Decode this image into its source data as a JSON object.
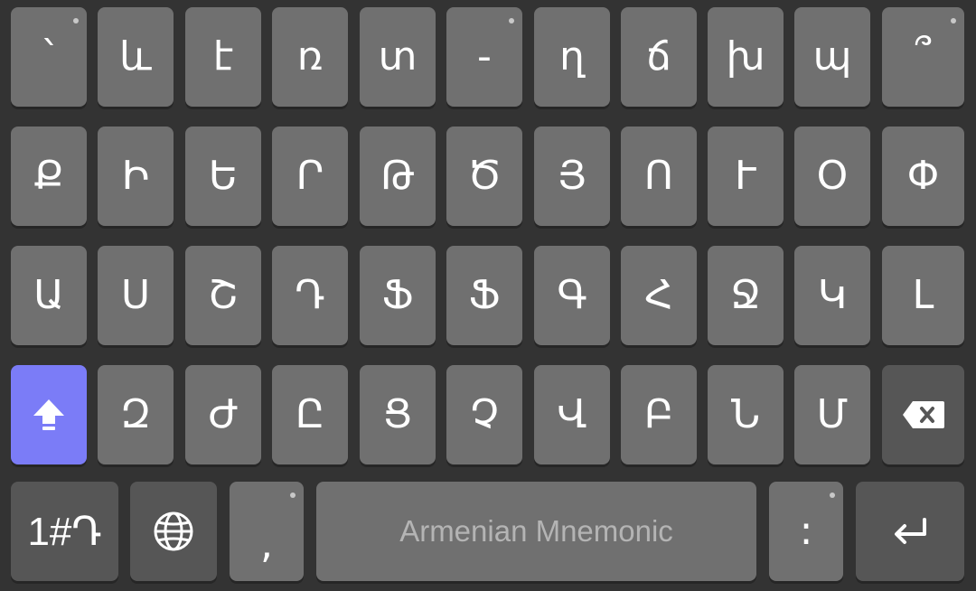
{
  "keyboard": {
    "rows": [
      [
        {
          "label": "՝",
          "hint": true,
          "name": "key-armenian-accent"
        },
        {
          "label": "և",
          "hint": false,
          "name": "key-ev"
        },
        {
          "label": "է",
          "hint": false,
          "name": "key-e-small"
        },
        {
          "label": "ռ",
          "hint": false,
          "name": "key-rra"
        },
        {
          "label": "տ",
          "hint": false,
          "name": "key-tiwn"
        },
        {
          "label": "-",
          "hint": true,
          "name": "key-hyphen"
        },
        {
          "label": "ղ",
          "hint": false,
          "name": "key-ghad"
        },
        {
          "label": "ճ",
          "hint": false,
          "name": "key-cheh"
        },
        {
          "label": "խ",
          "hint": false,
          "name": "key-xeh"
        },
        {
          "label": "պ",
          "hint": false,
          "name": "key-peh"
        },
        {
          "label": "՞",
          "hint": true,
          "name": "key-question-mark"
        }
      ],
      [
        {
          "label": "Ք",
          "hint": false,
          "name": "key-keh"
        },
        {
          "label": "Ի",
          "hint": false,
          "name": "key-ini"
        },
        {
          "label": "Ե",
          "hint": false,
          "name": "key-yech"
        },
        {
          "label": "Ր",
          "hint": false,
          "name": "key-reh"
        },
        {
          "label": "Թ",
          "hint": false,
          "name": "key-to"
        },
        {
          "label": "Ծ",
          "hint": false,
          "name": "key-ca"
        },
        {
          "label": "Յ",
          "hint": false,
          "name": "key-yi"
        },
        {
          "label": "Ո",
          "hint": false,
          "name": "key-vo"
        },
        {
          "label": "Ւ",
          "hint": false,
          "name": "key-yiwn"
        },
        {
          "label": "Օ",
          "hint": false,
          "name": "key-oh"
        },
        {
          "label": "Փ",
          "hint": false,
          "name": "key-piwr"
        }
      ],
      [
        {
          "label": "Ա",
          "hint": false,
          "name": "key-ayb"
        },
        {
          "label": "Ս",
          "hint": false,
          "name": "key-seh"
        },
        {
          "label": "Շ",
          "hint": false,
          "name": "key-sha"
        },
        {
          "label": "Դ",
          "hint": false,
          "name": "key-da"
        },
        {
          "label": "Ֆ",
          "hint": false,
          "name": "key-feh"
        },
        {
          "label": "Ֆ",
          "hint": false,
          "name": "key-feh-2"
        },
        {
          "label": "Գ",
          "hint": false,
          "name": "key-gim"
        },
        {
          "label": "Հ",
          "hint": false,
          "name": "key-ho"
        },
        {
          "label": "Ջ",
          "hint": false,
          "name": "key-jheh"
        },
        {
          "label": "Կ",
          "hint": false,
          "name": "key-ken"
        },
        {
          "label": "Լ",
          "hint": false,
          "name": "key-liwn"
        }
      ],
      [
        {
          "label": "Զ",
          "hint": false,
          "name": "key-za"
        },
        {
          "label": "Ժ",
          "hint": false,
          "name": "key-zhe"
        },
        {
          "label": "Ը",
          "hint": false,
          "name": "key-et"
        },
        {
          "label": "Ց",
          "hint": false,
          "name": "key-co"
        },
        {
          "label": "Չ",
          "hint": false,
          "name": "key-cha"
        },
        {
          "label": "Վ",
          "hint": false,
          "name": "key-vew"
        },
        {
          "label": "Բ",
          "hint": false,
          "name": "key-ben"
        },
        {
          "label": "Ն",
          "hint": false,
          "name": "key-now"
        },
        {
          "label": "Մ",
          "hint": false,
          "name": "key-men"
        }
      ]
    ],
    "bottom": {
      "symbols_label": "1#Դ",
      "comma_label": ",",
      "space_label": "Armenian Mnemonic",
      "colon_label": ":"
    },
    "icons": {
      "shift": "shift-icon",
      "backspace": "backspace-icon",
      "globe": "globe-icon",
      "enter": "enter-icon"
    },
    "colors": {
      "background": "#333333",
      "key": "#707070",
      "key_dark": "#565656",
      "accent": "#7b7cf7"
    }
  }
}
